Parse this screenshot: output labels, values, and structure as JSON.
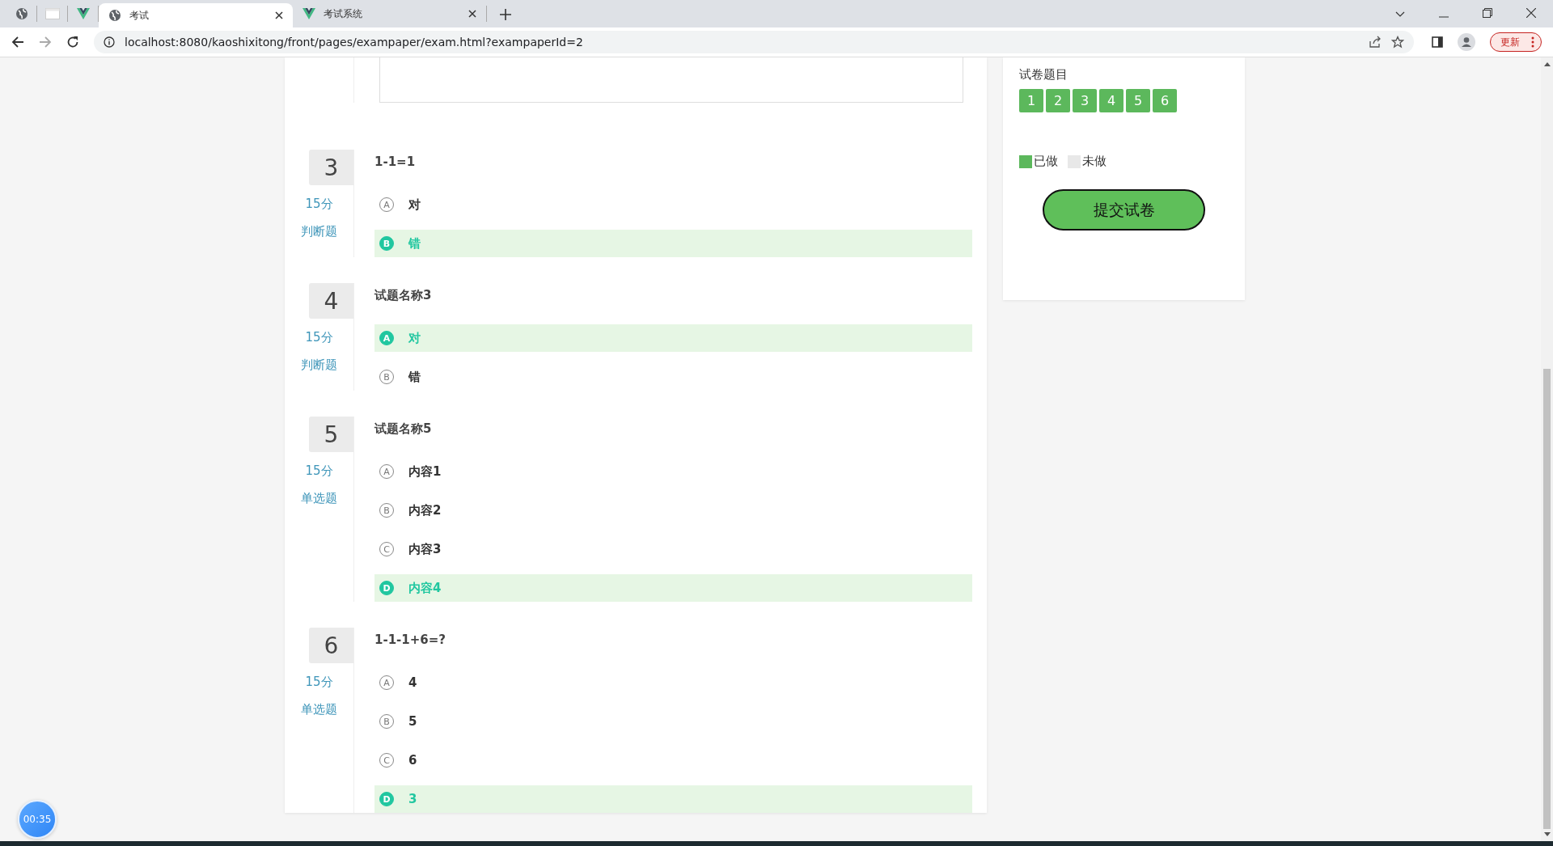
{
  "browser": {
    "tabs": [
      {
        "kind": "pinned",
        "selected": false
      },
      {
        "kind": "pinned",
        "selected": false
      },
      {
        "kind": "pinned",
        "selected": false
      },
      {
        "kind": "normal",
        "title": "考试",
        "selected": true
      },
      {
        "kind": "normal",
        "title": "考试系统",
        "selected": false
      }
    ],
    "url": "localhost:8080/kaoshixitong/front/pages/exampaper/exam.html?exampaperId=2",
    "update_button": "更新"
  },
  "questions": [
    {
      "number": "3",
      "score": "15分",
      "type": "判断题",
      "title": "1-1=1",
      "options": [
        {
          "letter": "A",
          "text": "对",
          "selected": false
        },
        {
          "letter": "B",
          "text": "错",
          "selected": true
        }
      ]
    },
    {
      "number": "4",
      "score": "15分",
      "type": "判断题",
      "title": "试题名称3",
      "options": [
        {
          "letter": "A",
          "text": "对",
          "selected": true
        },
        {
          "letter": "B",
          "text": "错",
          "selected": false
        }
      ]
    },
    {
      "number": "5",
      "score": "15分",
      "type": "单选题",
      "title": "试题名称5",
      "options": [
        {
          "letter": "A",
          "text": "内容1",
          "selected": false
        },
        {
          "letter": "B",
          "text": "内容2",
          "selected": false
        },
        {
          "letter": "C",
          "text": "内容3",
          "selected": false
        },
        {
          "letter": "D",
          "text": "内容4",
          "selected": true
        }
      ]
    },
    {
      "number": "6",
      "score": "15分",
      "type": "单选题",
      "title": "1-1-1+6=?",
      "options": [
        {
          "letter": "A",
          "text": "4",
          "selected": false
        },
        {
          "letter": "B",
          "text": "5",
          "selected": false
        },
        {
          "letter": "C",
          "text": "6",
          "selected": false
        },
        {
          "letter": "D",
          "text": "3",
          "selected": true
        }
      ]
    }
  ],
  "sidebar": {
    "title": "试卷题目",
    "numbers": [
      {
        "label": "1",
        "done": true
      },
      {
        "label": "2",
        "done": true
      },
      {
        "label": "3",
        "done": true
      },
      {
        "label": "4",
        "done": true
      },
      {
        "label": "5",
        "done": true
      },
      {
        "label": "6",
        "done": true
      }
    ],
    "legend": [
      {
        "label": "已做",
        "color": "#5cb85c"
      },
      {
        "label": "未做",
        "color": "#e8e8e8"
      }
    ],
    "submit_button": "提交试卷"
  },
  "timer": "00:35"
}
